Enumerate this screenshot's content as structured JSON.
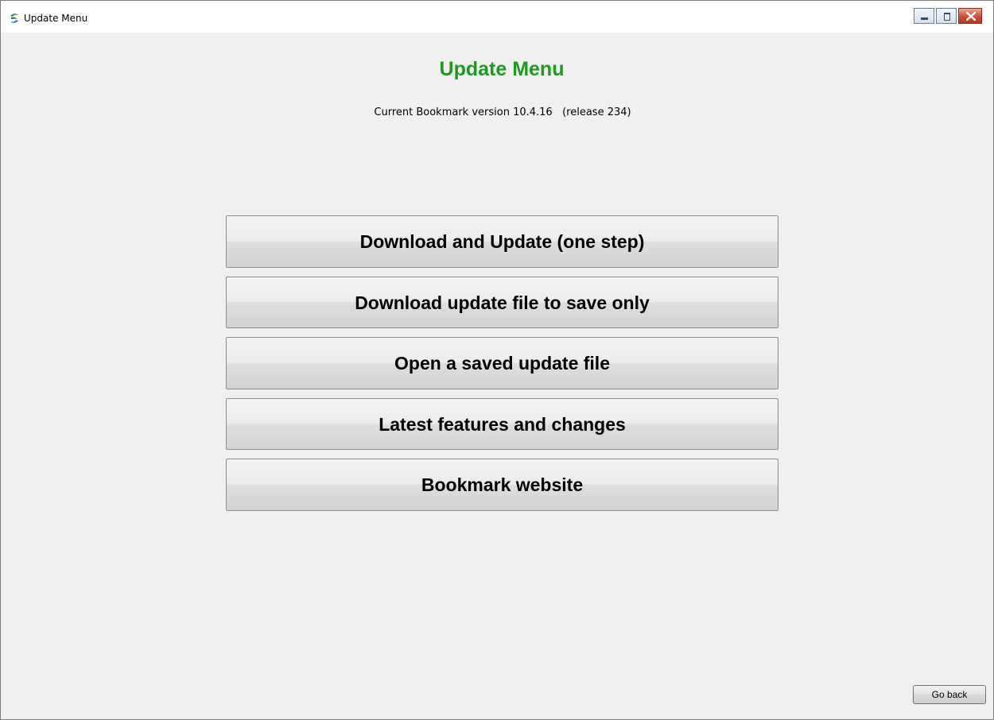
{
  "window": {
    "title": "Update Menu",
    "app_icon": "bookmark-swirl-icon",
    "controls": {
      "minimize": "minimize-icon",
      "maximize": "maximize-icon",
      "close": "close-icon"
    }
  },
  "main": {
    "heading": "Update Menu",
    "heading_color": "#1c9c1c",
    "version_text": "Current Bookmark version 10.4.16   (release 234)",
    "buttons": [
      {
        "label": "Download and Update (one step)"
      },
      {
        "label": "Download update file to save only"
      },
      {
        "label": "Open a saved update file"
      },
      {
        "label": "Latest features and changes"
      },
      {
        "label": "Bookmark website"
      }
    ],
    "back_button": "Go back"
  }
}
